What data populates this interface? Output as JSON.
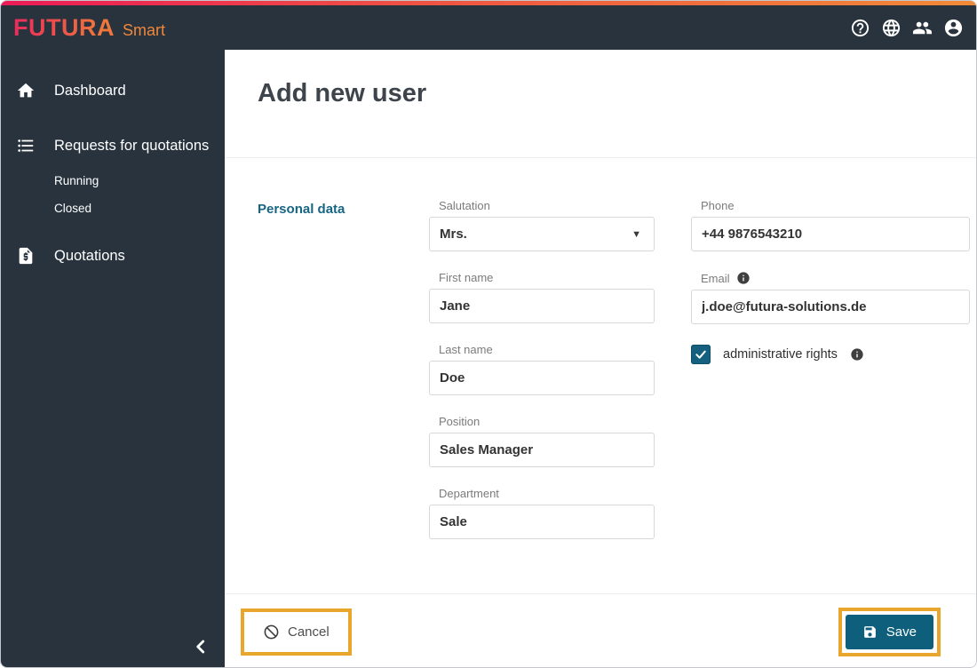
{
  "logo": {
    "primary": "FUTURA",
    "secondary": "Smart"
  },
  "header": {
    "icons": [
      "help",
      "language",
      "users",
      "account"
    ]
  },
  "sidebar": {
    "dashboard": "Dashboard",
    "requests": "Requests for quotations",
    "running": "Running",
    "closed": "Closed",
    "quotations": "Quotations"
  },
  "page": {
    "title": "Add new user",
    "section": "Personal data"
  },
  "form": {
    "salutation": {
      "label": "Salutation",
      "value": "Mrs."
    },
    "first_name": {
      "label": "First name",
      "value": "Jane"
    },
    "last_name": {
      "label": "Last name",
      "value": "Doe"
    },
    "position": {
      "label": "Position",
      "value": "Sales Manager"
    },
    "department": {
      "label": "Department",
      "value": "Sale"
    },
    "phone": {
      "label": "Phone",
      "value": "+44 9876543210"
    },
    "email": {
      "label": "Email",
      "value": "j.doe@futura-solutions.de",
      "has_info": true
    },
    "admin_rights": {
      "label": "administrative rights",
      "checked": true,
      "has_info": true
    }
  },
  "actions": {
    "cancel": "Cancel",
    "save": "Save"
  },
  "colors": {
    "accent_teal": "#0d5f7c",
    "checkbox_teal": "#15607e",
    "sidebar_bg": "#28333e",
    "section_label": "#176583",
    "highlight_orange": "#e9a62c",
    "logo_gradient_start": "#ec1b57",
    "logo_gradient_end": "#f18a37"
  }
}
